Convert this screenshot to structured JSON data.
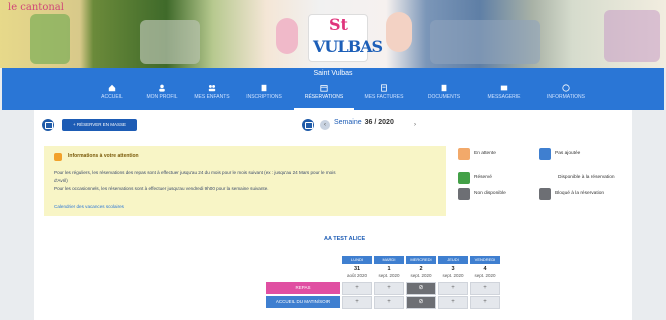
{
  "banner": {
    "script_text": "le cantonal",
    "logo_st": "St",
    "logo_name": "VULBAS"
  },
  "nav": {
    "title": "Saint Vulbas",
    "tabs": [
      {
        "label": "ACCUEIL"
      },
      {
        "label": "MON PROFIL"
      },
      {
        "label": "MES ENFANTS"
      },
      {
        "label": "INSCRIPTIONS"
      },
      {
        "label": "RÉSERVATIONS"
      },
      {
        "label": "MES FACTURES"
      },
      {
        "label": "DOCUMENTS"
      },
      {
        "label": "MESSAGERIE"
      },
      {
        "label": "INFORMATIONS"
      }
    ]
  },
  "toolbar": {
    "reserve_label": "+ RÉSERVER EN MASSE"
  },
  "week": {
    "prefix": "Semaine",
    "value": "36 / 2020",
    "prev": "‹",
    "next": "›"
  },
  "info": {
    "heading": "Informations à votre attention",
    "lines": [
      "Pour les réguliers, les réservations des repas sont à effectuer jusqu'au 24 du mois pour le mois suivant (ex : jusqu'au 24 Mars pour le mois",
      "d'Avril)",
      "Pour les occasionnels, les réservations sont à effectuer jusqu'au vendredi 9h00 pour la semaine suivante."
    ],
    "link": "Calendrier des vacances scolaires"
  },
  "legend": {
    "a_valider": "En attente",
    "a_annuler": "Pas ajoutée",
    "reserve": "Réservé",
    "disponible": "Disponible à la réservation",
    "non_disponible": "Non disponible",
    "bloque": "Bloqué à la réservation"
  },
  "child": {
    "name": "AA TEST ALICE"
  },
  "days": [
    {
      "name": "LUNDI",
      "num": "31",
      "month": "août 2020"
    },
    {
      "name": "MARDI",
      "num": "1",
      "month": "sept. 2020"
    },
    {
      "name": "MERCREDI",
      "num": "2",
      "month": "sept. 2020"
    },
    {
      "name": "JEUDI",
      "num": "3",
      "month": "sept. 2020"
    },
    {
      "name": "VENDREDI",
      "num": "4",
      "month": "sept. 2020"
    }
  ],
  "rows": [
    {
      "label": "REPAS",
      "cells": [
        "+",
        "+",
        "⊘",
        "+",
        "+"
      ]
    },
    {
      "label": "ACCUEIL DU MATIN/SOIR",
      "cells": [
        "+",
        "+",
        "⊘",
        "+",
        "+"
      ]
    }
  ],
  "colors": {
    "nav": "#2a76d6",
    "info_bg": "#f8f5c6",
    "repas": "#e04fa2",
    "accueil": "#3f7fd0"
  }
}
